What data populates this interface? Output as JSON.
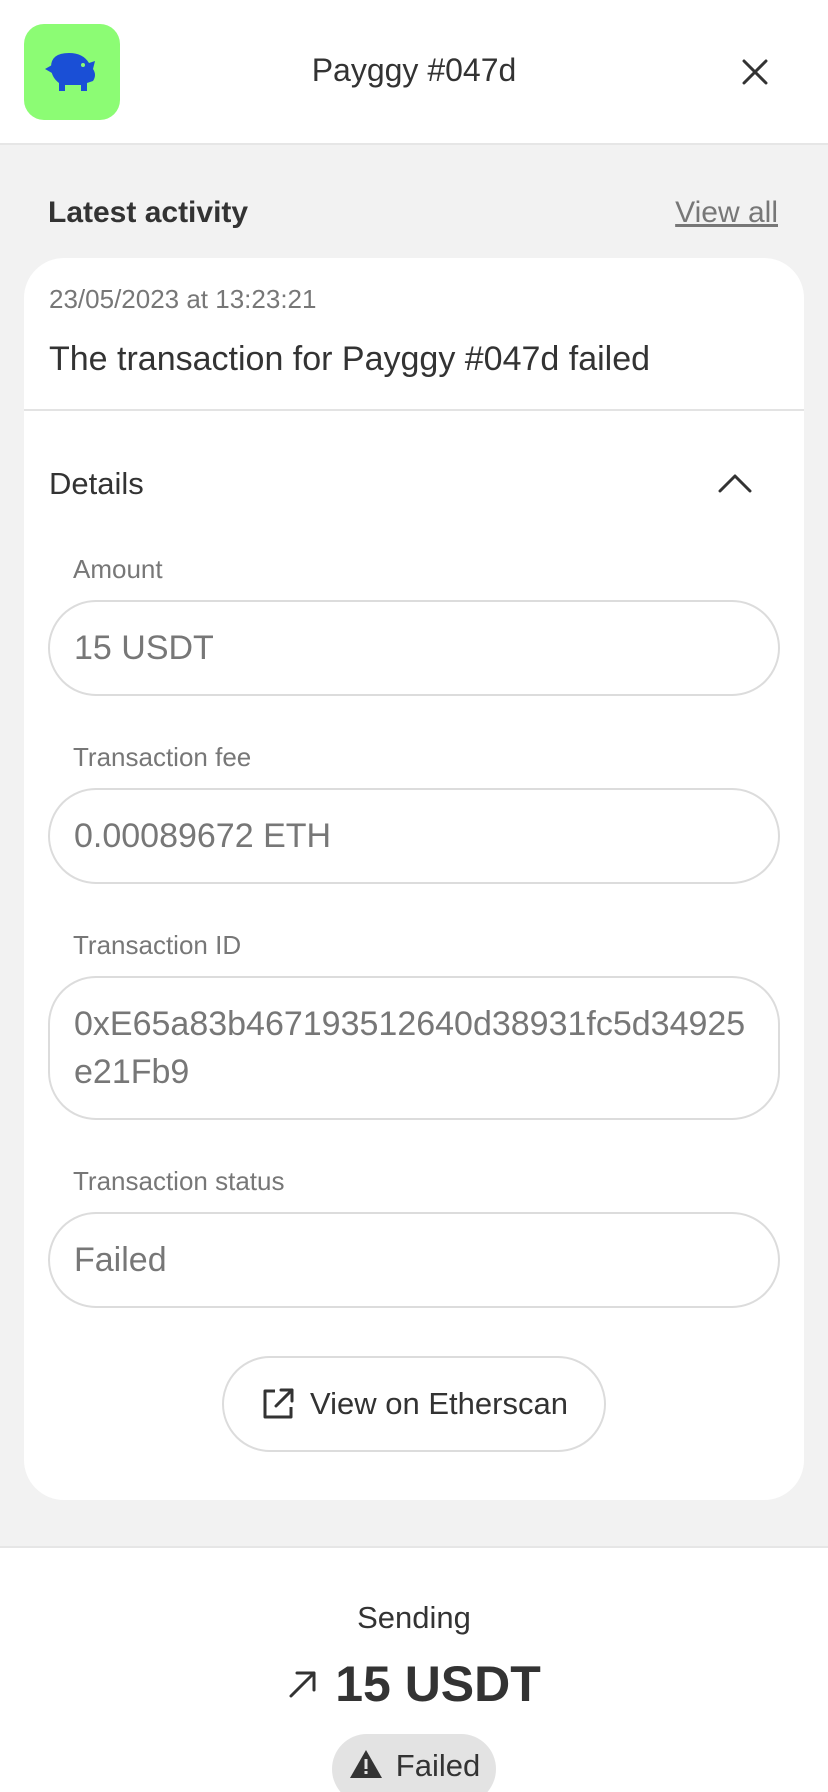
{
  "header": {
    "title": "Payggy #047d",
    "app_icon": "piggy-bank-icon",
    "app_icon_bg": "#8cfc74",
    "app_icon_color": "#1a4fd6",
    "close_icon": "close-icon"
  },
  "activity": {
    "section_title": "Latest activity",
    "view_all_label": "View all",
    "timestamp": "23/05/2023 at 13:23:21",
    "message": "The transaction for Payggy #047d failed",
    "details_label": "Details",
    "details_toggle_icon": "chevron-up-icon",
    "fields": [
      {
        "label": "Amount",
        "value": "15 USDT"
      },
      {
        "label": "Transaction fee",
        "value": "0.00089672 ETH"
      },
      {
        "label": "Transaction ID",
        "value": "0xE65a83b467193512640d38931fc5d34925e21Fb9"
      },
      {
        "label": "Transaction status",
        "value": "Failed"
      }
    ],
    "etherscan_button_label": "View on Etherscan",
    "etherscan_icon": "external-link-icon"
  },
  "footer": {
    "sending_label": "Sending",
    "amount": "15 USDT",
    "direction_icon": "arrow-up-right-icon",
    "status_label": "Failed",
    "status_icon": "warning-icon"
  }
}
